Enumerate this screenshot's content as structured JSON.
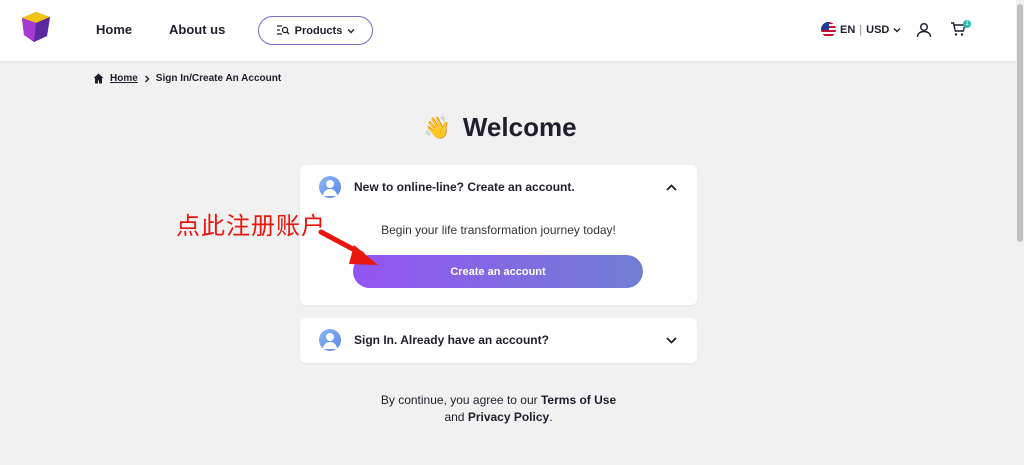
{
  "header": {
    "nav": {
      "home": "Home",
      "about": "About us",
      "products": "Products"
    },
    "locale": {
      "language": "EN",
      "separator": "|",
      "currency": "USD"
    },
    "cart_count": "1"
  },
  "breadcrumb": {
    "home": "Home",
    "current": "Sign In/Create An Account"
  },
  "welcome": {
    "emoji": "👋",
    "title": "Welcome"
  },
  "create_panel": {
    "title": "New to online-line? Create an account.",
    "subtitle": "Begin your life transformation journey today!",
    "button": "Create an account"
  },
  "signin_panel": {
    "title": "Sign In. Already have an account?"
  },
  "annotation": {
    "text": "点此注册账户",
    "color": "#e8160c"
  },
  "terms": {
    "prefix": "By continue, you agree to our",
    "terms_link": "Terms of Use",
    "and": "and",
    "privacy_link": "Privacy Policy",
    "period": "."
  },
  "colors": {
    "accent": "#9454f2",
    "accent_end": "#6f7fd3",
    "badge": "#2bb9b0"
  }
}
